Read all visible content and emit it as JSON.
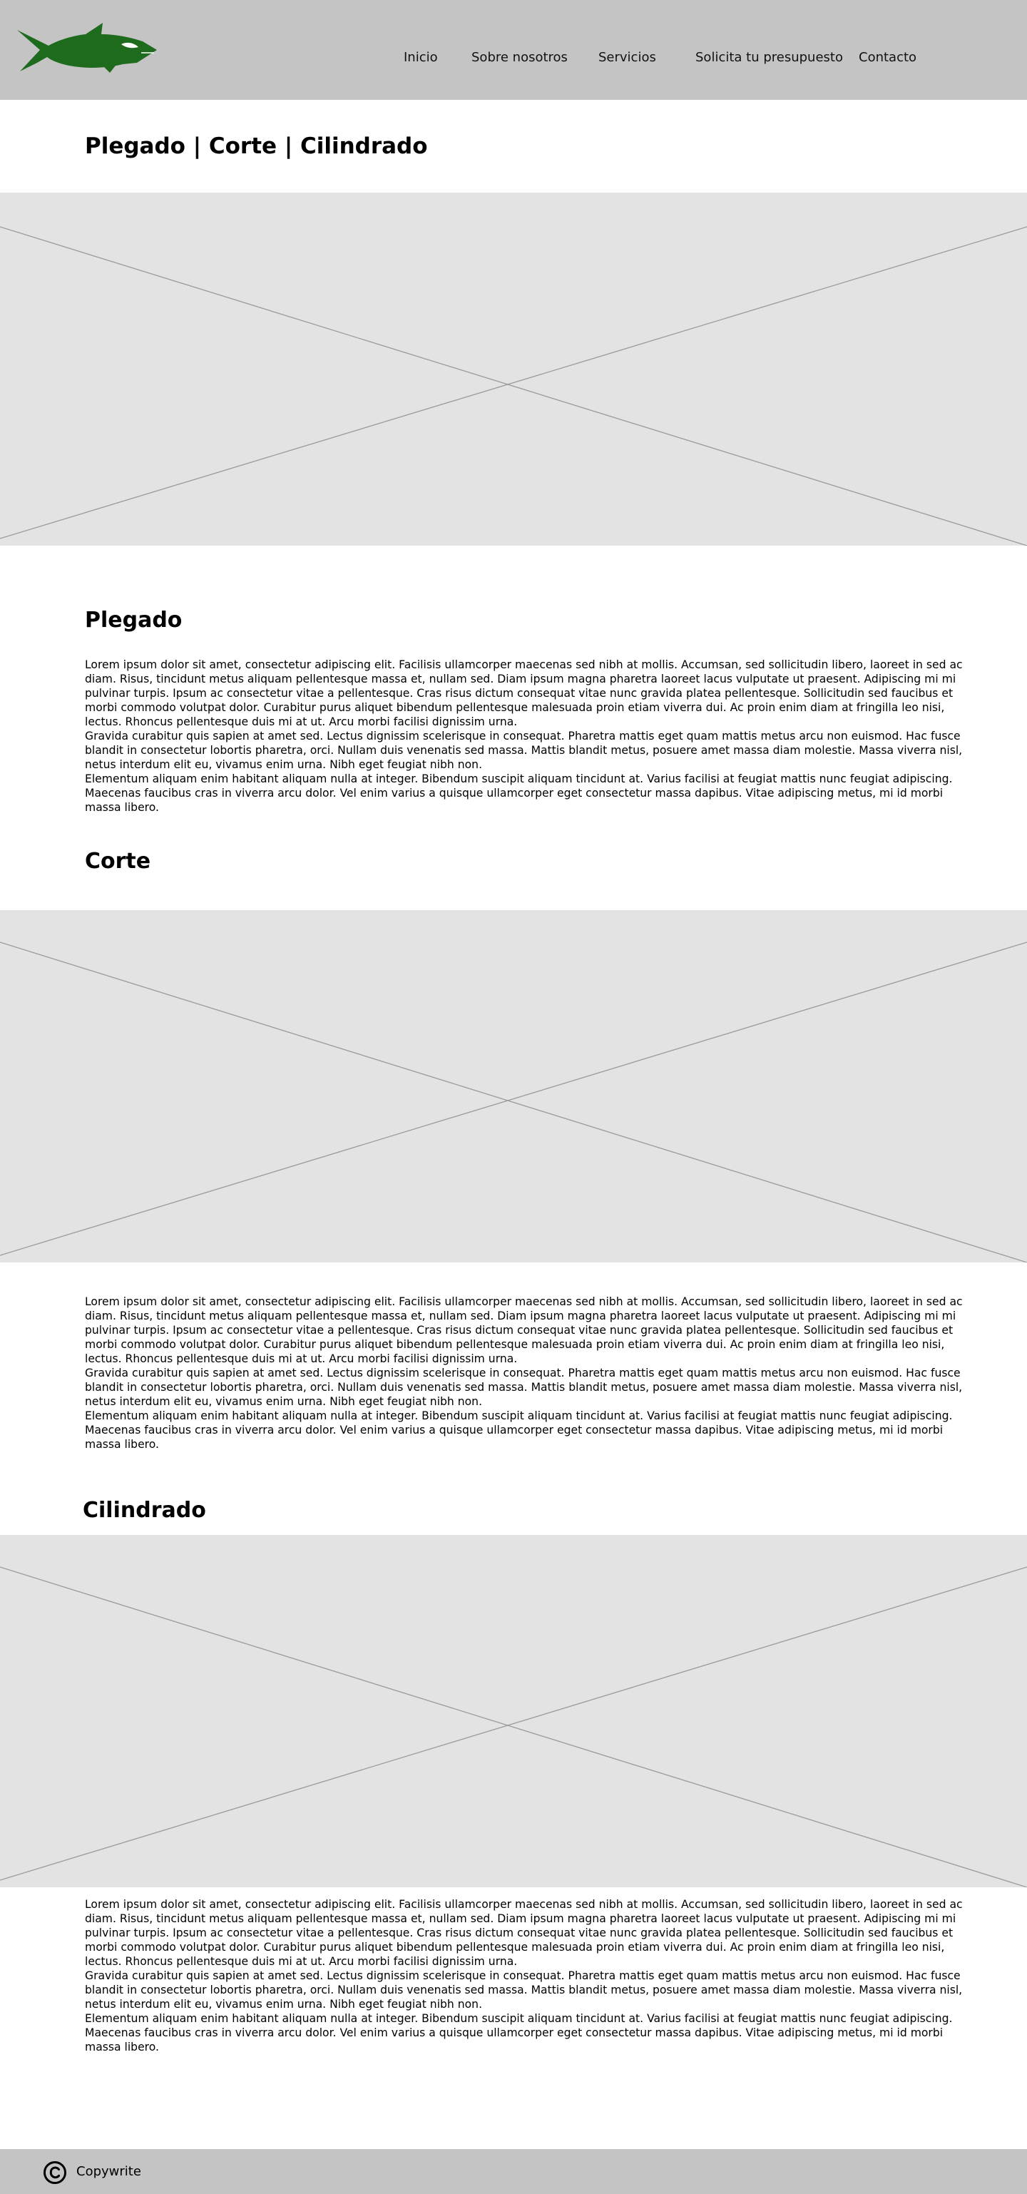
{
  "colors": {
    "header_bg": "#c4c4c4",
    "footer_bg": "#c4c4c4",
    "placeholder_bg": "#e3e3e3",
    "logo_green": "#1e6b1e"
  },
  "header": {
    "logo_icon": "shark-logo-icon",
    "nav": [
      "Inicio",
      "Sobre nosotros",
      "Servicios",
      "Solicita tu presupuesto",
      "Contacto"
    ]
  },
  "page_title": "Plegado | Corte | Cilindrado",
  "sections": {
    "plegado": {
      "title": "Plegado",
      "paragraphs": [
        "Lorem ipsum dolor sit amet, consectetur adipiscing elit. Facilisis ullamcorper maecenas sed nibh at mollis. Accumsan, sed sollicitudin libero, laoreet in sed ac diam. Risus, tincidunt metus aliquam pellentesque massa et, nullam sed. Diam ipsum magna pharetra laoreet lacus vulputate ut praesent. Adipiscing mi mi pulvinar turpis. Ipsum ac consectetur vitae a pellentesque. Cras risus dictum consequat vitae nunc gravida platea pellentesque. Sollicitudin sed faucibus et morbi commodo volutpat dolor. Curabitur purus aliquet bibendum pellentesque malesuada proin etiam viverra dui. Ac proin enim diam at fringilla leo nisi, lectus. Rhoncus pellentesque duis mi at ut. Arcu morbi facilisi dignissim urna.",
        "Gravida curabitur quis sapien at amet sed. Lectus dignissim scelerisque in consequat. Pharetra mattis eget quam mattis metus arcu non euismod. Hac fusce blandit in consectetur lobortis pharetra, orci. Nullam duis venenatis sed massa. Mattis blandit metus, posuere amet massa diam molestie. Massa viverra nisl, netus interdum elit eu, vivamus enim urna. Nibh eget feugiat nibh non.",
        "Elementum aliquam enim habitant aliquam nulla at integer. Bibendum suscipit aliquam tincidunt at. Varius facilisi at feugiat mattis nunc feugiat adipiscing. Maecenas faucibus cras in viverra arcu dolor. Vel enim varius a quisque ullamcorper eget consectetur massa dapibus. Vitae adipiscing metus, mi id morbi massa libero."
      ]
    },
    "corte": {
      "title": "Corte",
      "paragraphs": [
        "Lorem ipsum dolor sit amet, consectetur adipiscing elit. Facilisis ullamcorper maecenas sed nibh at mollis. Accumsan, sed sollicitudin libero, laoreet in sed ac diam. Risus, tincidunt metus aliquam pellentesque massa et, nullam sed. Diam ipsum magna pharetra laoreet lacus vulputate ut praesent. Adipiscing mi mi pulvinar turpis. Ipsum ac consectetur vitae a pellentesque. Cras risus dictum consequat vitae nunc gravida platea pellentesque. Sollicitudin sed faucibus et morbi commodo volutpat dolor. Curabitur purus aliquet bibendum pellentesque malesuada proin etiam viverra dui. Ac proin enim diam at fringilla leo nisi, lectus. Rhoncus pellentesque duis mi at ut. Arcu morbi facilisi dignissim urna.",
        "Gravida curabitur quis sapien at amet sed. Lectus dignissim scelerisque in consequat. Pharetra mattis eget quam mattis metus arcu non euismod. Hac fusce blandit in consectetur lobortis pharetra, orci. Nullam duis venenatis sed massa. Mattis blandit metus, posuere amet massa diam molestie. Massa viverra nisl, netus interdum elit eu, vivamus enim urna. Nibh eget feugiat nibh non.",
        "Elementum aliquam enim habitant aliquam nulla at integer. Bibendum suscipit aliquam tincidunt at. Varius facilisi at feugiat mattis nunc feugiat adipiscing. Maecenas faucibus cras in viverra arcu dolor. Vel enim varius a quisque ullamcorper eget consectetur massa dapibus. Vitae adipiscing metus, mi id morbi massa libero."
      ]
    },
    "cilindrado": {
      "title": "Cilindrado",
      "paragraphs": [
        "Lorem ipsum dolor sit amet, consectetur adipiscing elit. Facilisis ullamcorper maecenas sed nibh at mollis. Accumsan, sed sollicitudin libero, laoreet in sed ac diam. Risus, tincidunt metus aliquam pellentesque massa et, nullam sed. Diam ipsum magna pharetra laoreet lacus vulputate ut praesent. Adipiscing mi mi pulvinar turpis. Ipsum ac consectetur vitae a pellentesque. Cras risus dictum consequat vitae nunc gravida platea pellentesque. Sollicitudin sed faucibus et morbi commodo volutpat dolor. Curabitur purus aliquet bibendum pellentesque malesuada proin etiam viverra dui. Ac proin enim diam at fringilla leo nisi, lectus. Rhoncus pellentesque duis mi at ut. Arcu morbi facilisi dignissim urna.",
        "Gravida curabitur quis sapien at amet sed. Lectus dignissim scelerisque in consequat. Pharetra mattis eget quam mattis metus arcu non euismod. Hac fusce blandit in consectetur lobortis pharetra, orci. Nullam duis venenatis sed massa. Mattis blandit metus, posuere amet massa diam molestie. Massa viverra nisl, netus interdum elit eu, vivamus enim urna. Nibh eget feugiat nibh non.",
        "Elementum aliquam enim habitant aliquam nulla at integer. Bibendum suscipit aliquam tincidunt at. Varius facilisi at feugiat mattis nunc feugiat adipiscing. Maecenas faucibus cras in viverra arcu dolor. Vel enim varius a quisque ullamcorper eget consectetur massa dapibus. Vitae adipiscing metus, mi id morbi massa libero."
      ]
    }
  },
  "footer": {
    "icon": "copyright-icon",
    "label": "Copywrite"
  }
}
